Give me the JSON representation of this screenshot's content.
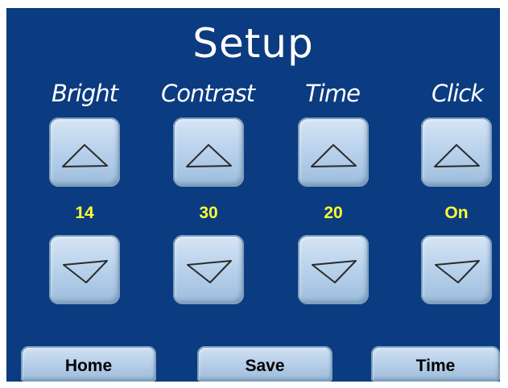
{
  "screen": {
    "title": "Setup"
  },
  "controls": [
    {
      "label": "Bright",
      "value": "14"
    },
    {
      "label": "Contrast",
      "value": "30"
    },
    {
      "label": "Time",
      "value": "20"
    },
    {
      "label": "Click",
      "value": "On"
    }
  ],
  "footer": {
    "home_label": "Home",
    "save_label": "Save",
    "time_label": "Time"
  },
  "colors": {
    "panel": "#0b3b80",
    "value_text": "#ffff33",
    "label_text": "#ffffff",
    "button_face": "#b9d2ec"
  },
  "icons": {
    "up": "triangle-up-icon",
    "down": "triangle-down-icon"
  }
}
